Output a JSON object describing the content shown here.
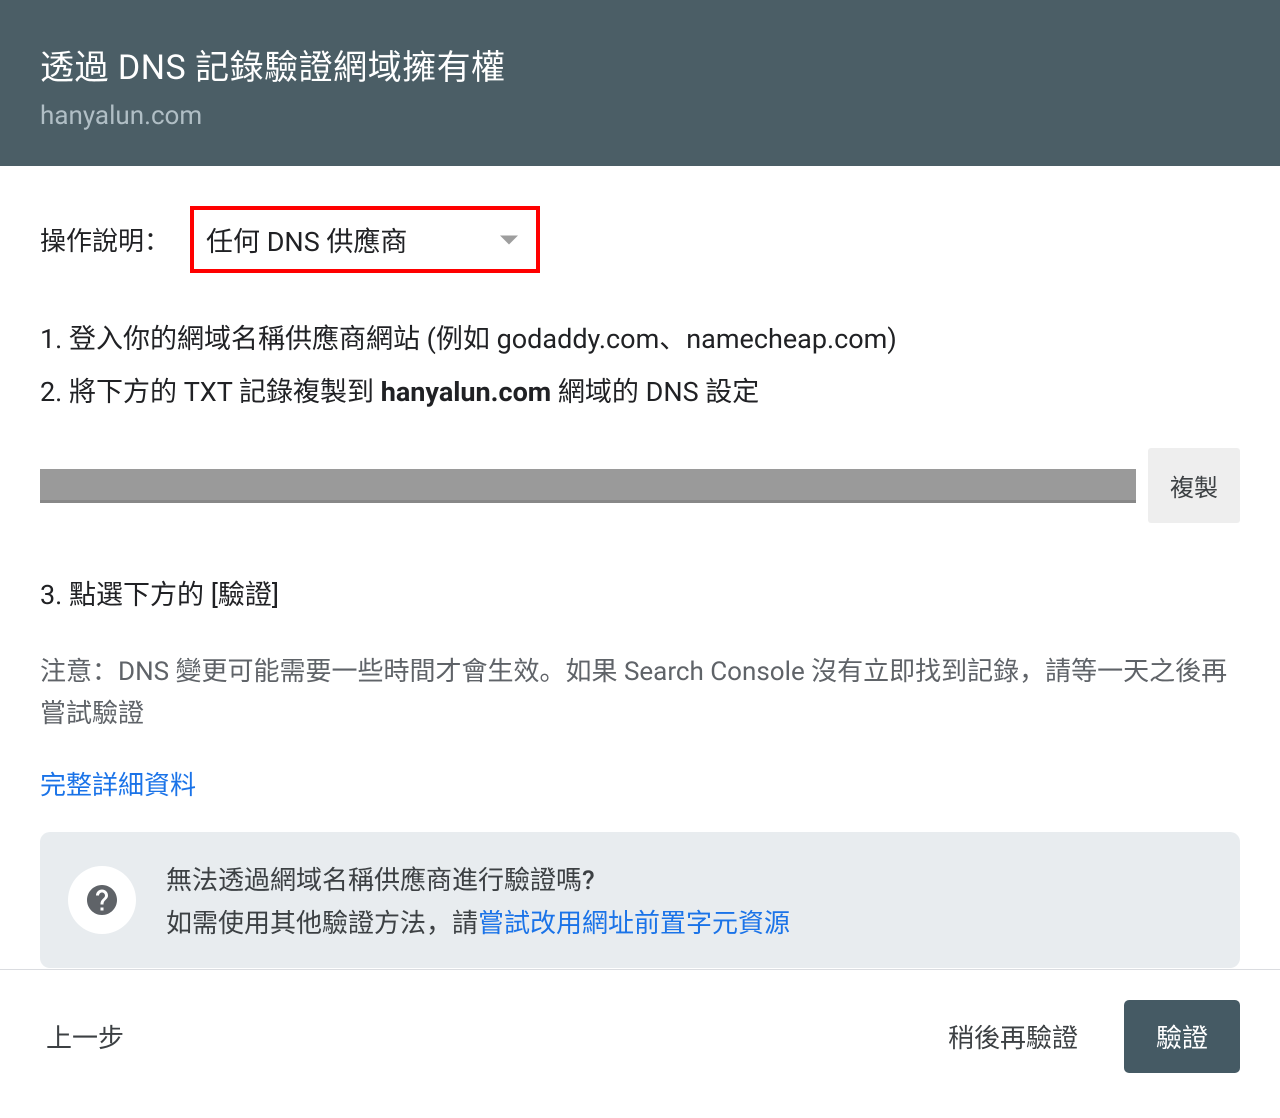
{
  "header": {
    "title": "透過 DNS 記錄驗證網域擁有權",
    "domain": "hanyalun.com"
  },
  "select": {
    "label": "操作說明：",
    "value": "任何 DNS 供應商"
  },
  "steps": {
    "s1": "1. 登入你的網域名稱供應商網站 (例如 godaddy.com、namecheap.com)",
    "s2_prefix": "2. 將下方的 TXT 記錄複製到 ",
    "s2_domain": "hanyalun.com",
    "s2_suffix": " 網域的 DNS 設定",
    "s3": "3. 點選下方的 [驗證]"
  },
  "copy_button": "複製",
  "note": "注意：DNS 變更可能需要一些時間才會生效。如果 Search Console 沒有立即找到記錄，請等一天之後再嘗試驗證",
  "details_link": "完整詳細資料",
  "help": {
    "title": "無法透過網域名稱供應商進行驗證嗎?",
    "body_prefix": "如需使用其他驗證方法，請",
    "body_link": "嘗試改用網址前置字元資源"
  },
  "footer": {
    "back": "上一步",
    "later": "稍後再驗證",
    "verify": "驗證"
  }
}
